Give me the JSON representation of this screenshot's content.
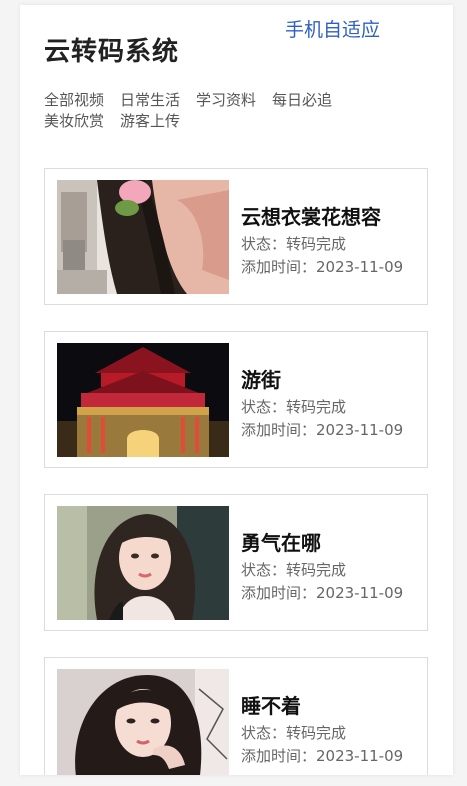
{
  "header": {
    "mobile_link": "手机自适应",
    "site_title": "云转码系统"
  },
  "nav": [
    {
      "label": "全部视频"
    },
    {
      "label": "日常生活"
    },
    {
      "label": "学习资料"
    },
    {
      "label": "每日必追"
    },
    {
      "label": "美妆欣赏"
    },
    {
      "label": "游客上传"
    }
  ],
  "videos": [
    {
      "title": "云想衣裳花想容",
      "status": "状态：转码完成",
      "added": "添加时间：2023-11-09"
    },
    {
      "title": "游街",
      "status": "状态：转码完成",
      "added": "添加时间：2023-11-09"
    },
    {
      "title": "勇气在哪",
      "status": "状态：转码完成",
      "added": "添加时间：2023-11-09"
    },
    {
      "title": "睡不着",
      "status": "状态：转码完成",
      "added": "添加时间：2023-11-09"
    }
  ],
  "colors": {
    "link": "#2f5fc4",
    "title": "#222222",
    "card_border": "#dcdcdc"
  }
}
